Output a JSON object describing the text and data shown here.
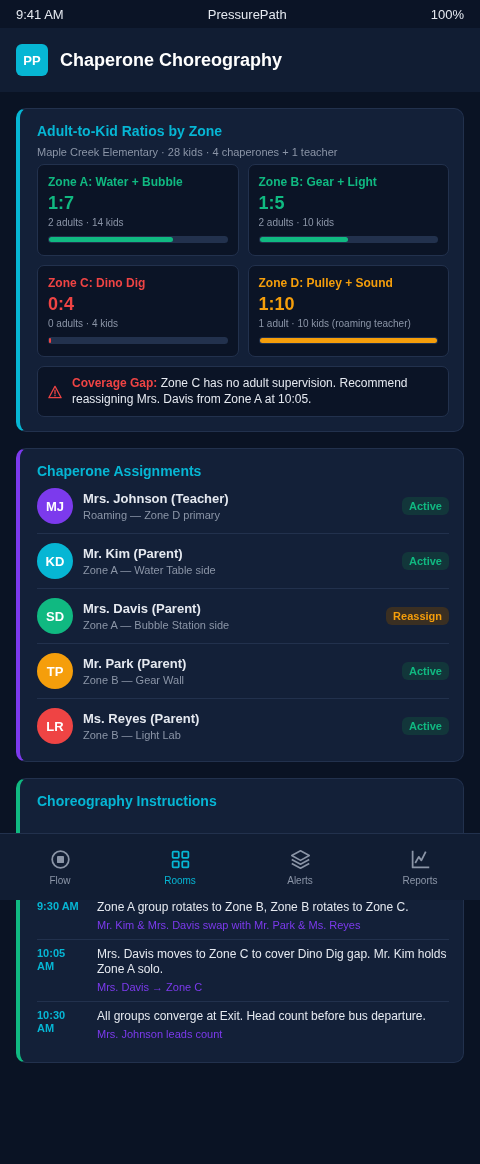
{
  "status_bar": {
    "time": "9:41 AM",
    "app": "PressurePath",
    "battery": "100%"
  },
  "header": {
    "logo": "PP",
    "title": "Chaperone Choreography"
  },
  "ratios": {
    "title": "Adult-to-Kid Ratios by Zone",
    "subtitle": "Maple Creek Elementary · 28 kids · 4 chaperones + 1 teacher",
    "zones": [
      {
        "name": "Zone A: Water + Bubble",
        "ratio": "1:7",
        "detail": "2 adults · 14 kids",
        "level": 0.7,
        "color": "#10b981"
      },
      {
        "name": "Zone B: Gear + Light",
        "ratio": "1:5",
        "detail": "2 adults · 10 kids",
        "level": 0.5,
        "color": "#10b981"
      },
      {
        "name": "Zone C: Dino Dig",
        "ratio": "0:4",
        "detail": "0 adults · 4 kids",
        "level": 0,
        "color": "#ef4444"
      },
      {
        "name": "Zone D: Pulley + Sound",
        "ratio": "1:10",
        "detail": "1 adult · 10 kids (roaming teacher)",
        "level": 1,
        "color": "#f59e0b"
      }
    ],
    "alert": {
      "label": "Coverage Gap:",
      "text": "Zone C has no adult supervision. Recommend reassigning Mrs. Davis from Zone A at 10:05."
    }
  },
  "assignments": {
    "title": "Chaperone Assignments",
    "people": [
      {
        "initials": "MJ",
        "name": "Mrs. Johnson (Teacher)",
        "role": "Roaming — Zone D primary",
        "color": "#7c3aed",
        "kind": "active",
        "badge": "Active"
      },
      {
        "initials": "KD",
        "name": "Mr. Kim (Parent)",
        "role": "Zone A — Water Table side",
        "color": "#06b6d4",
        "kind": "active",
        "badge": "Active"
      },
      {
        "initials": "SD",
        "name": "Mrs. Davis (Parent)",
        "role": "Zone A — Bubble Station side",
        "color": "#10b981",
        "kind": "reassign",
        "badge": "Reassign"
      },
      {
        "initials": "TP",
        "name": "Mr. Park (Parent)",
        "role": "Zone B — Gear Wall",
        "color": "#f59e0b",
        "kind": "active",
        "badge": "Active"
      },
      {
        "initials": "LR",
        "name": "Ms. Reyes (Parent)",
        "role": "Zone B — Light Lab",
        "color": "#ef4444",
        "kind": "active",
        "badge": "Active"
      }
    ]
  },
  "instructions": {
    "title": "Choreography Instructions",
    "steps": [
      {
        "time": "9:30 AM",
        "text": "Zone A group rotates to Zone B, Zone B rotates to Zone C.",
        "note": "Mr. Kim & Mrs. Davis swap with Mr. Park & Ms. Reyes"
      },
      {
        "time": "10:05 AM",
        "text": "Mrs. Davis moves to Zone C to cover Dino Dig gap. Mr. Kim holds Zone A solo.",
        "note": "Mrs. Davis → Zone C"
      },
      {
        "time": "10:30 AM",
        "text": "All groups converge at Exit. Head count before bus departure.",
        "note": "Mrs. Johnson leads count"
      }
    ]
  },
  "nav": [
    {
      "label": "Flow",
      "kind": "stop",
      "selected": false
    },
    {
      "label": "Rooms",
      "kind": "grid",
      "selected": true
    },
    {
      "label": "Alerts",
      "kind": "layers",
      "selected": false
    },
    {
      "label": "Reports",
      "kind": "chart",
      "selected": false
    }
  ]
}
